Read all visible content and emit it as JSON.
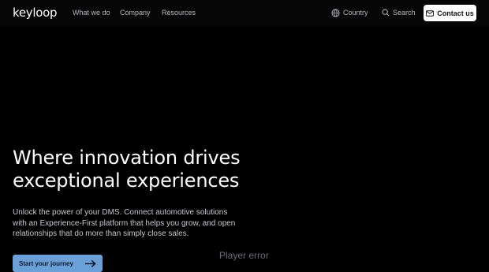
{
  "brand": {
    "logo_text": "keyloop"
  },
  "nav": {
    "links": [
      {
        "label": "What we do"
      },
      {
        "label": "Company"
      },
      {
        "label": "Resources"
      }
    ],
    "country_label": "Country",
    "search_label": "Search",
    "contact_label": "Contact us"
  },
  "hero": {
    "headline_line1": "Where innovation drives",
    "headline_line2": "exceptional experiences",
    "subcopy_line1": "Unlock the power of your DMS. Connect automotive solutions",
    "subcopy_line2": "with an Experience-First platform that helps you grow, and open",
    "subcopy_line3": "relationships that do more than simply close sales.",
    "cta_label": "Start your journey"
  },
  "video": {
    "error_text": "Player error"
  },
  "colors": {
    "background": "#000000",
    "cta": "#6b9fd8",
    "contact_button": "#ffffff",
    "nav_text": "#b9bcc3"
  },
  "icons": [
    "globe-icon",
    "search-icon",
    "envelope-icon",
    "arrow-right-icon"
  ]
}
